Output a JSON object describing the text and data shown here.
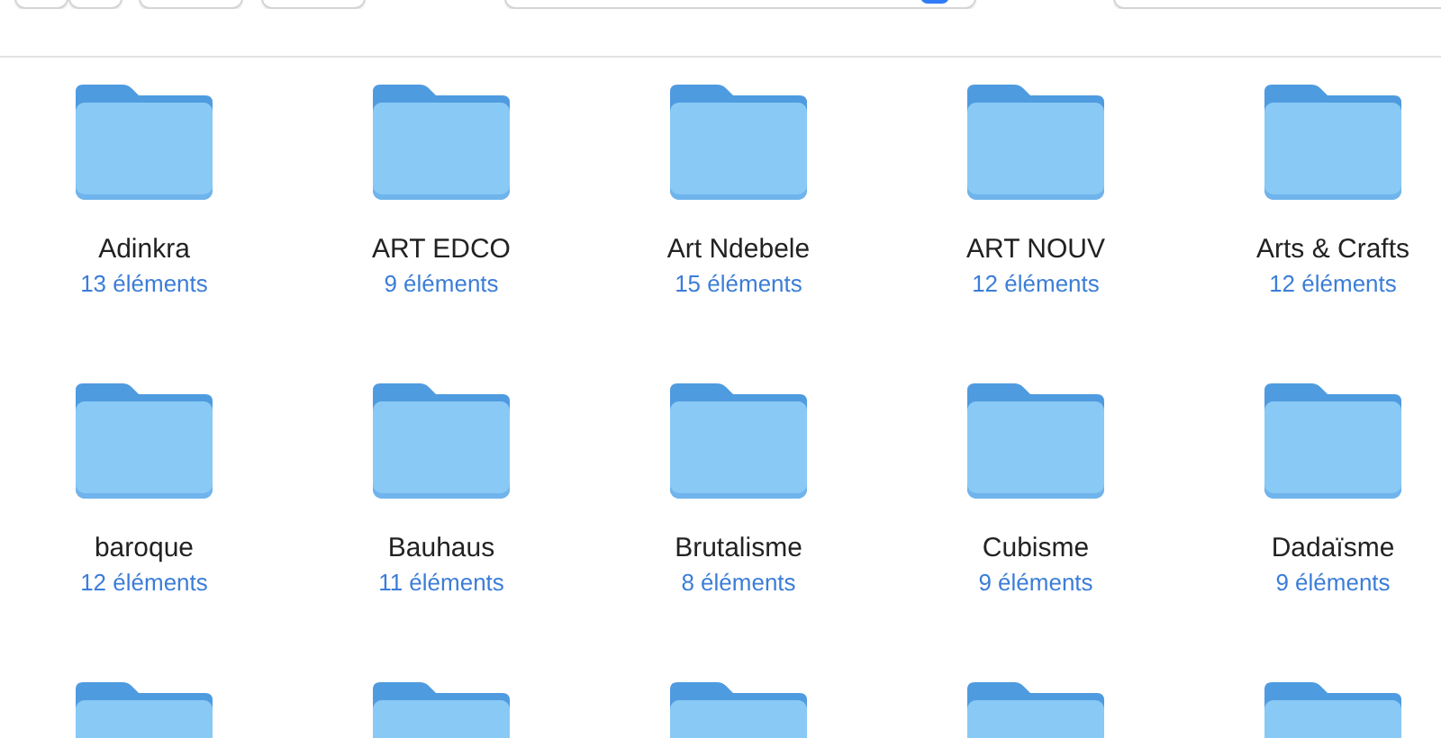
{
  "toolbar": {
    "controls": [
      {
        "kind": "back"
      },
      {
        "kind": "forward"
      },
      {
        "kind": "button"
      },
      {
        "kind": "button"
      },
      {
        "kind": "search"
      },
      {
        "kind": "field"
      }
    ]
  },
  "items": [
    {
      "kind": "folder",
      "name": "Adinkra",
      "count": "13 éléments"
    },
    {
      "kind": "folder",
      "name": "ART EDCO",
      "count": "9 éléments"
    },
    {
      "kind": "folder",
      "name": "Art Ndebele",
      "count": "15 éléments"
    },
    {
      "kind": "folder",
      "name": "ART NOUV",
      "count": "12 éléments"
    },
    {
      "kind": "folder",
      "name": "Arts & Crafts",
      "count": "12 éléments"
    },
    {
      "kind": "folder",
      "name": "baroque",
      "count": "12 éléments"
    },
    {
      "kind": "folder",
      "name": "Bauhaus",
      "count": "11 éléments"
    },
    {
      "kind": "folder",
      "name": "Brutalisme",
      "count": "8 éléments"
    },
    {
      "kind": "folder",
      "name": "Cubisme",
      "count": "9 éléments"
    },
    {
      "kind": "folder",
      "name": "Dadaïsme",
      "count": "9 éléments"
    },
    {
      "kind": "folder"
    },
    {
      "kind": "folder"
    },
    {
      "kind": "folder"
    },
    {
      "kind": "folder"
    },
    {
      "kind": "folder"
    }
  ]
}
